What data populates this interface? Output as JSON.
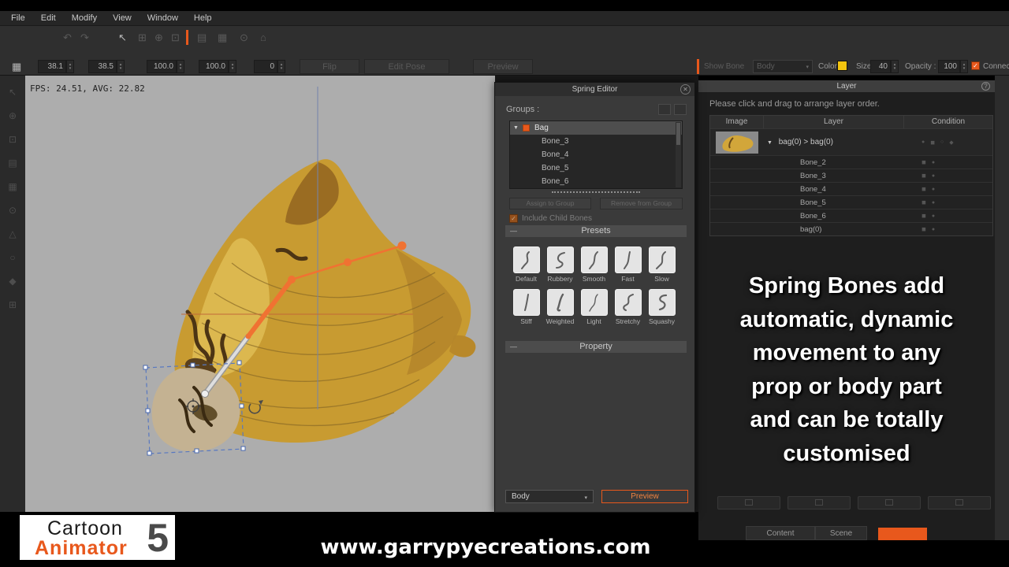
{
  "icons": {
    "chevron_down": "▼",
    "caret_down": "▾",
    "spin_up": "▴",
    "spin_down": "▾",
    "close": "✕",
    "info": "?",
    "check": "✓",
    "dash": "—",
    "undo": "↶",
    "redo": "↷",
    "select": "↖",
    "grid": "▦",
    "grid3": "⊞",
    "target": "⊙",
    "home": "⌂",
    "box": "⊡",
    "plus": "⊕",
    "rows": "▤",
    "diamond": "◆",
    "square": "◼",
    "circle": "●",
    "tri": "△",
    "ring": "○"
  },
  "menu": {
    "items": [
      "File",
      "Edit",
      "Modify",
      "View",
      "Window",
      "Help"
    ]
  },
  "transform_toolbar": {
    "x": "38.1",
    "y": "38.5",
    "scale_x": "100.0",
    "scale_y": "100.0",
    "rotation": "0",
    "flip_label": "Flip",
    "edit_pose_label": "Edit Pose",
    "preview_label": "Preview"
  },
  "bone_toolbar": {
    "show_bone_label": "Show Bone",
    "mode": "Body",
    "color_label": "Color :",
    "color_hex": "#f2c40f",
    "size_label": "Size :",
    "size_value": "40",
    "opacity_label": "Opacity :",
    "opacity_value": "100",
    "connect_label": "Connect"
  },
  "canvas": {
    "fps": "FPS: 24.51, AVG: 22.82"
  },
  "spring_editor": {
    "title": "Spring Editor",
    "groups_label": "Groups :",
    "tree": [
      "Bag",
      "Bone_3",
      "Bone_4",
      "Bone_5",
      "Bone_6"
    ],
    "assign_label": "Assign to Group",
    "remove_label": "Remove from Group",
    "include_child_label": "Include Child Bones",
    "presets_label": "Presets",
    "presets": [
      "Default",
      "Rubbery",
      "Smooth",
      "Fast",
      "Slow",
      "Stiff",
      "Weighted",
      "Light",
      "Stretchy",
      "Squashy"
    ],
    "property_label": "Property",
    "target_value": "Body",
    "preview_label": "Preview"
  },
  "layer_panel": {
    "title": "Layer",
    "hint": "Please click and drag to arrange layer order.",
    "columns": [
      "Image",
      "Layer",
      "Condition"
    ],
    "rows": [
      "bag(0) > bag(0)",
      "Bone_2",
      "Bone_3",
      "Bone_4",
      "Bone_5",
      "Bone_6",
      "bag(0)"
    ]
  },
  "promo": {
    "lines": [
      "Spring Bones add",
      "automatic, dynamic",
      "movement to any",
      "prop or body part",
      "and can be totally",
      "customised"
    ]
  },
  "tabs": {
    "content": "Content",
    "scene": "Scene"
  },
  "footer": {
    "brand_top": "Cartoon",
    "brand_bottom": "Animator",
    "brand_version": "5",
    "website": "www.garrypyecreations.com"
  },
  "colors": {
    "accent": "#e8581c",
    "bone_color": "#f2c40f",
    "canvas_bg": "#adadad"
  }
}
